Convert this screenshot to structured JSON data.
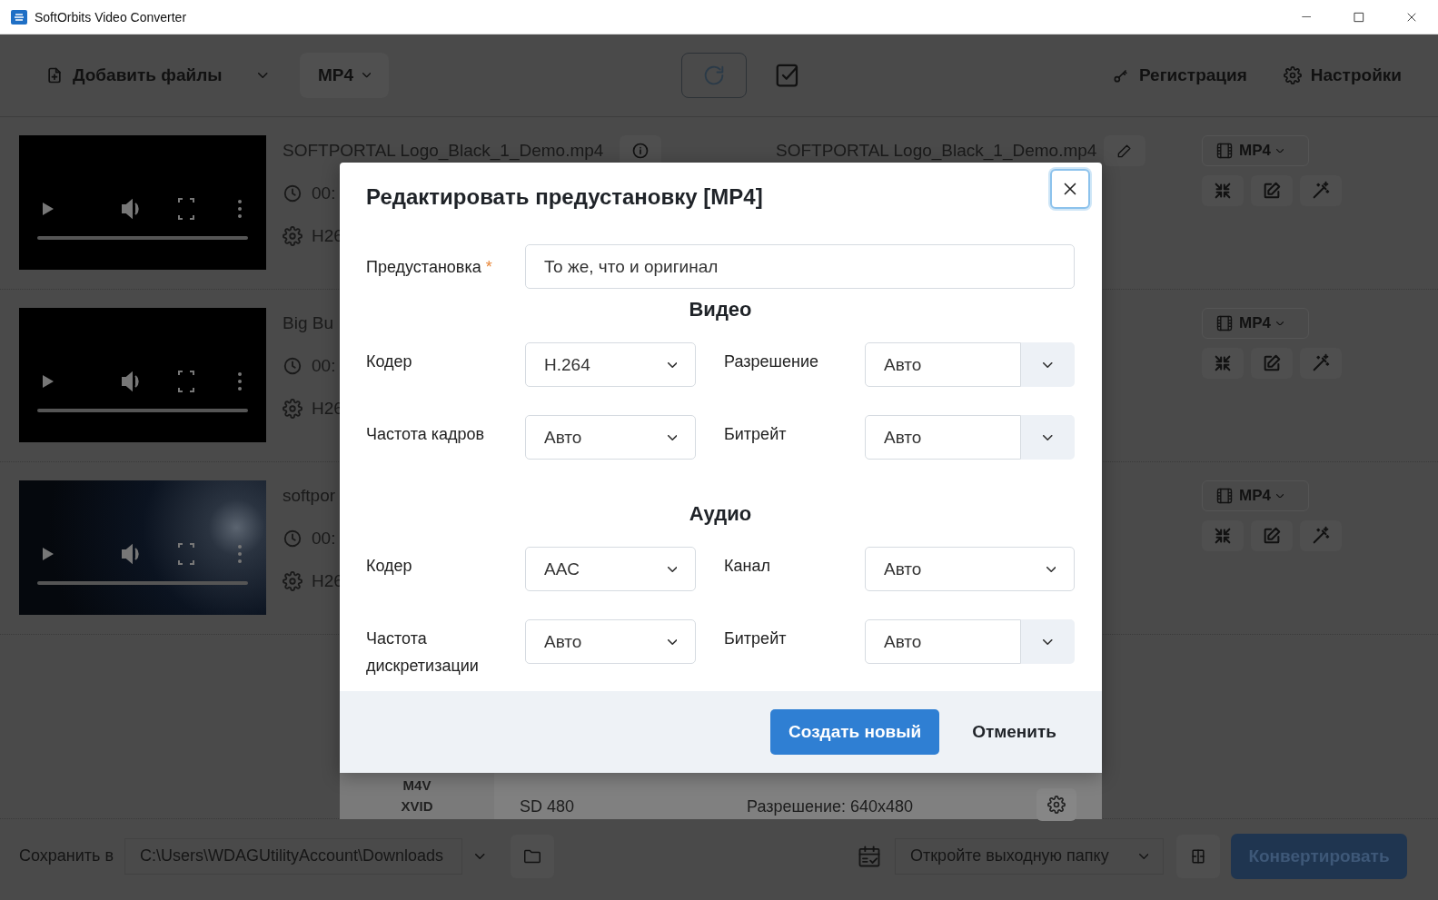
{
  "window": {
    "title": "SoftOrbits Video Converter"
  },
  "toolbar": {
    "add_files": "Добавить файлы",
    "format": "MP4",
    "registration": "Регистрация",
    "settings": "Настройки"
  },
  "files": [
    {
      "name": "SOFTPORTAL Logo_Black_1_Demo.mp4",
      "duration": "00:",
      "codec": "H26",
      "kind": "black",
      "output_name": "SOFTPORTAL Logo_Black_1_Demo.mp4",
      "format": "MP4"
    },
    {
      "name": "Big Bu",
      "duration": "00:",
      "codec": "H26",
      "kind": "black",
      "format": "MP4"
    },
    {
      "name": "softpor",
      "duration": "00:",
      "codec": "H26",
      "kind": "image",
      "format": "MP4"
    }
  ],
  "format_menu": {
    "formats": [
      "M4V",
      "XVID"
    ],
    "preset": "SD 480",
    "resolution": "Разрешение: 640x480"
  },
  "bottom_bar": {
    "save_label": "Сохранить в",
    "save_path": "C:\\Users\\WDAGUtilityAccount\\Downloads",
    "after_action": "Откройте выходную папку",
    "convert": "Конвертировать"
  },
  "dialog": {
    "title": "Редактировать предустановку [MP4]",
    "preset_label": "Предустановка",
    "required_mark": "*",
    "preset_value": "То же, что и оригинал",
    "sections": [
      {
        "title": "Видео",
        "fields": [
          {
            "label": "Кодер",
            "value": "H.264",
            "kind": "select"
          },
          {
            "label": "Разрешение",
            "value": "Авто",
            "kind": "combo"
          },
          {
            "label": "Частота кадров",
            "value": "Авто",
            "kind": "select"
          },
          {
            "label": "Битрейт",
            "value": "Авто",
            "kind": "combo"
          }
        ]
      },
      {
        "title": "Аудио",
        "fields": [
          {
            "label": "Кодер",
            "value": "AAC",
            "kind": "select"
          },
          {
            "label": "Канал",
            "value": "Авто",
            "kind": "select"
          },
          {
            "label": "Частота дискретизации",
            "value": "Авто",
            "kind": "select"
          },
          {
            "label": "Битрейт",
            "value": "Авто",
            "kind": "combo"
          }
        ]
      }
    ],
    "primary_button": "Создать новый",
    "cancel_button": "Отменить"
  }
}
